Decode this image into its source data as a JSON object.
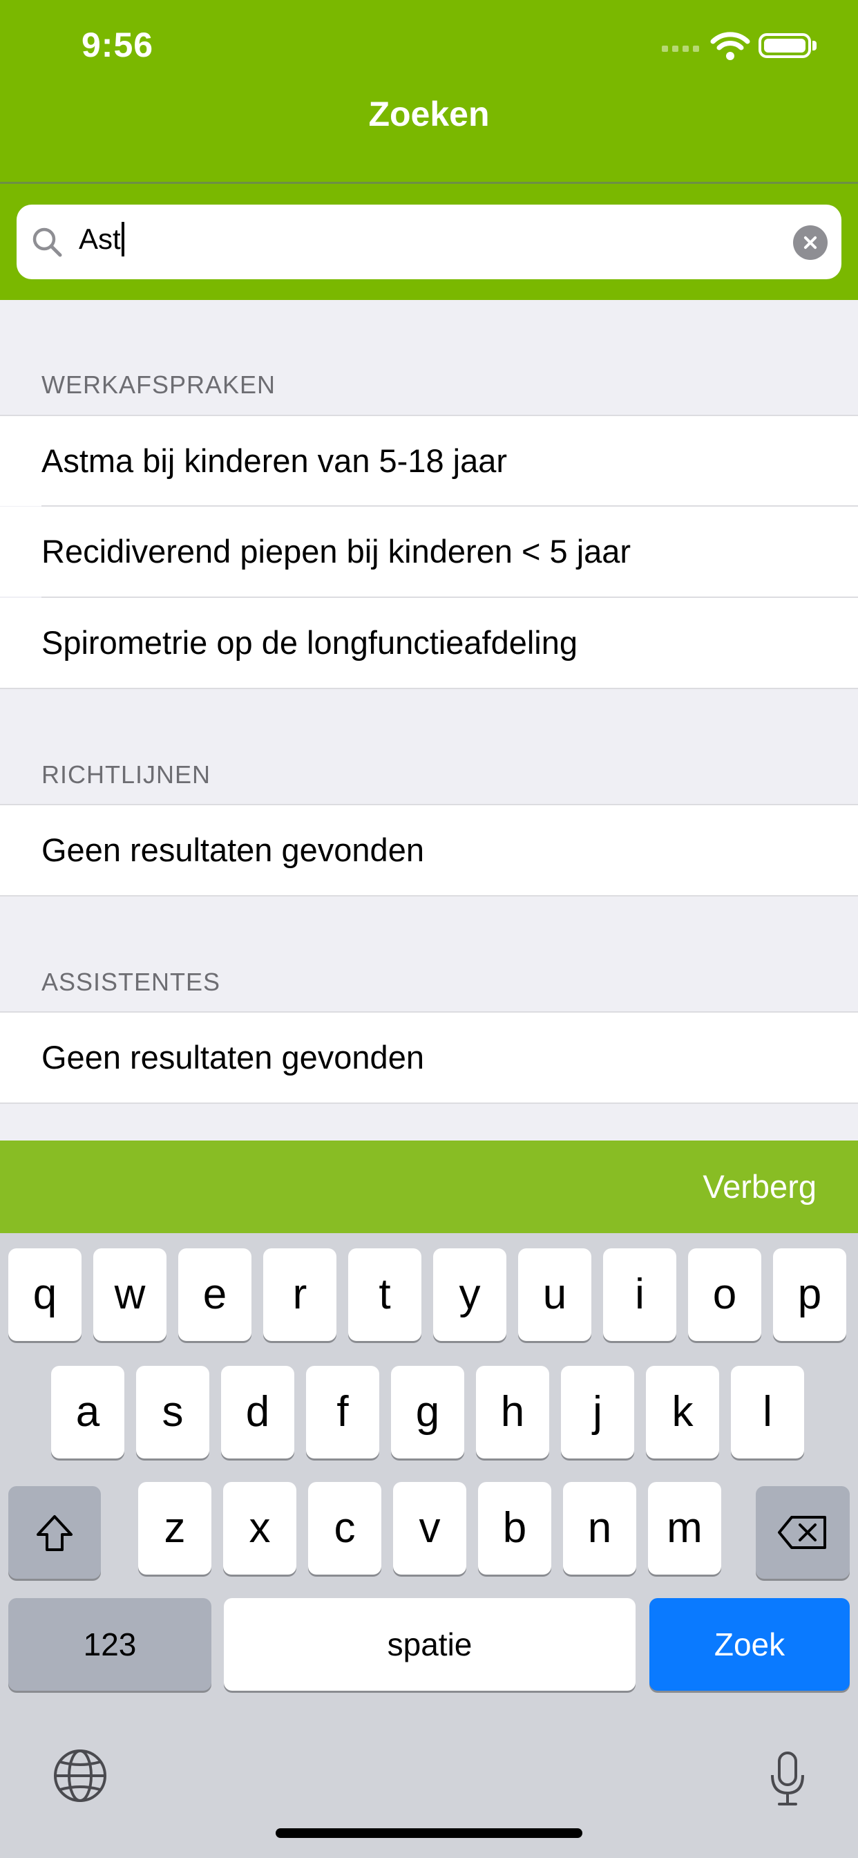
{
  "status_bar": {
    "time": "9:56"
  },
  "nav": {
    "title": "Zoeken"
  },
  "search": {
    "value": "Ast"
  },
  "sections": {
    "werkafspraken": {
      "header": "WERKAFSPRAKEN",
      "items": [
        "Astma bij kinderen van 5-18 jaar",
        "Recidiverend piepen bij kinderen < 5 jaar",
        "Spirometrie op de longfunctieafdeling"
      ]
    },
    "richtlijnen": {
      "header": "RICHTLIJNEN",
      "empty": "Geen resultaten gevonden"
    },
    "assistentes": {
      "header": "ASSISTENTES",
      "empty": "Geen resultaten gevonden"
    }
  },
  "accessory": {
    "hide_label": "Verberg"
  },
  "keyboard": {
    "row1": [
      "q",
      "w",
      "e",
      "r",
      "t",
      "y",
      "u",
      "i",
      "o",
      "p"
    ],
    "row2": [
      "a",
      "s",
      "d",
      "f",
      "g",
      "h",
      "j",
      "k",
      "l"
    ],
    "row3": [
      "z",
      "x",
      "c",
      "v",
      "b",
      "n",
      "m"
    ],
    "numbers_label": "123",
    "space_label": "spatie",
    "return_label": "Zoek"
  },
  "colors": {
    "brand_green": "#7ab800",
    "accessory_green": "#88bd24",
    "key_blue": "#0a7aff"
  }
}
